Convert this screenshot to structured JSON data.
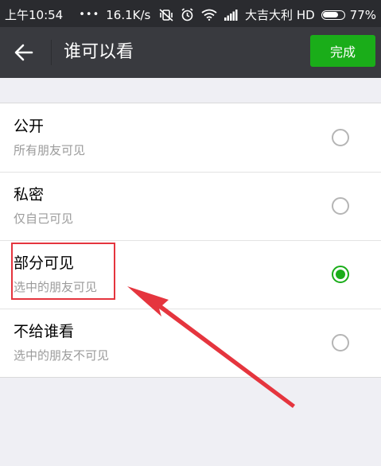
{
  "status_bar": {
    "time": "上午10:54",
    "dots": "•••",
    "speed": "16.1K/s",
    "carrier": "大吉大利 HD",
    "battery_text": "77%",
    "battery_level": 0.77,
    "icons": [
      "vibrate-off-icon",
      "alarm-icon",
      "wifi-icon",
      "signal-icon",
      "battery-icon"
    ]
  },
  "toolbar": {
    "back_icon": "arrow-left-icon",
    "title": "谁可以看",
    "done_label": "完成"
  },
  "options": [
    {
      "title": "公开",
      "subtitle": "所有朋友可见",
      "selected": false
    },
    {
      "title": "私密",
      "subtitle": "仅自己可见",
      "selected": false
    },
    {
      "title": "部分可见",
      "subtitle": "选中的朋友可见",
      "selected": true
    },
    {
      "title": "不给谁看",
      "subtitle": "选中的朋友不可见",
      "selected": false
    }
  ],
  "colors": {
    "status_bar_bg": "#2a2b2f",
    "toolbar_bg": "#393a3f",
    "accent_green": "#1aad19",
    "page_bg": "#efeff4",
    "annotation_red": "#e5353e"
  },
  "annotation": {
    "highlighted_option": "部分可见",
    "arrow_icon": "red-arrow-icon"
  }
}
